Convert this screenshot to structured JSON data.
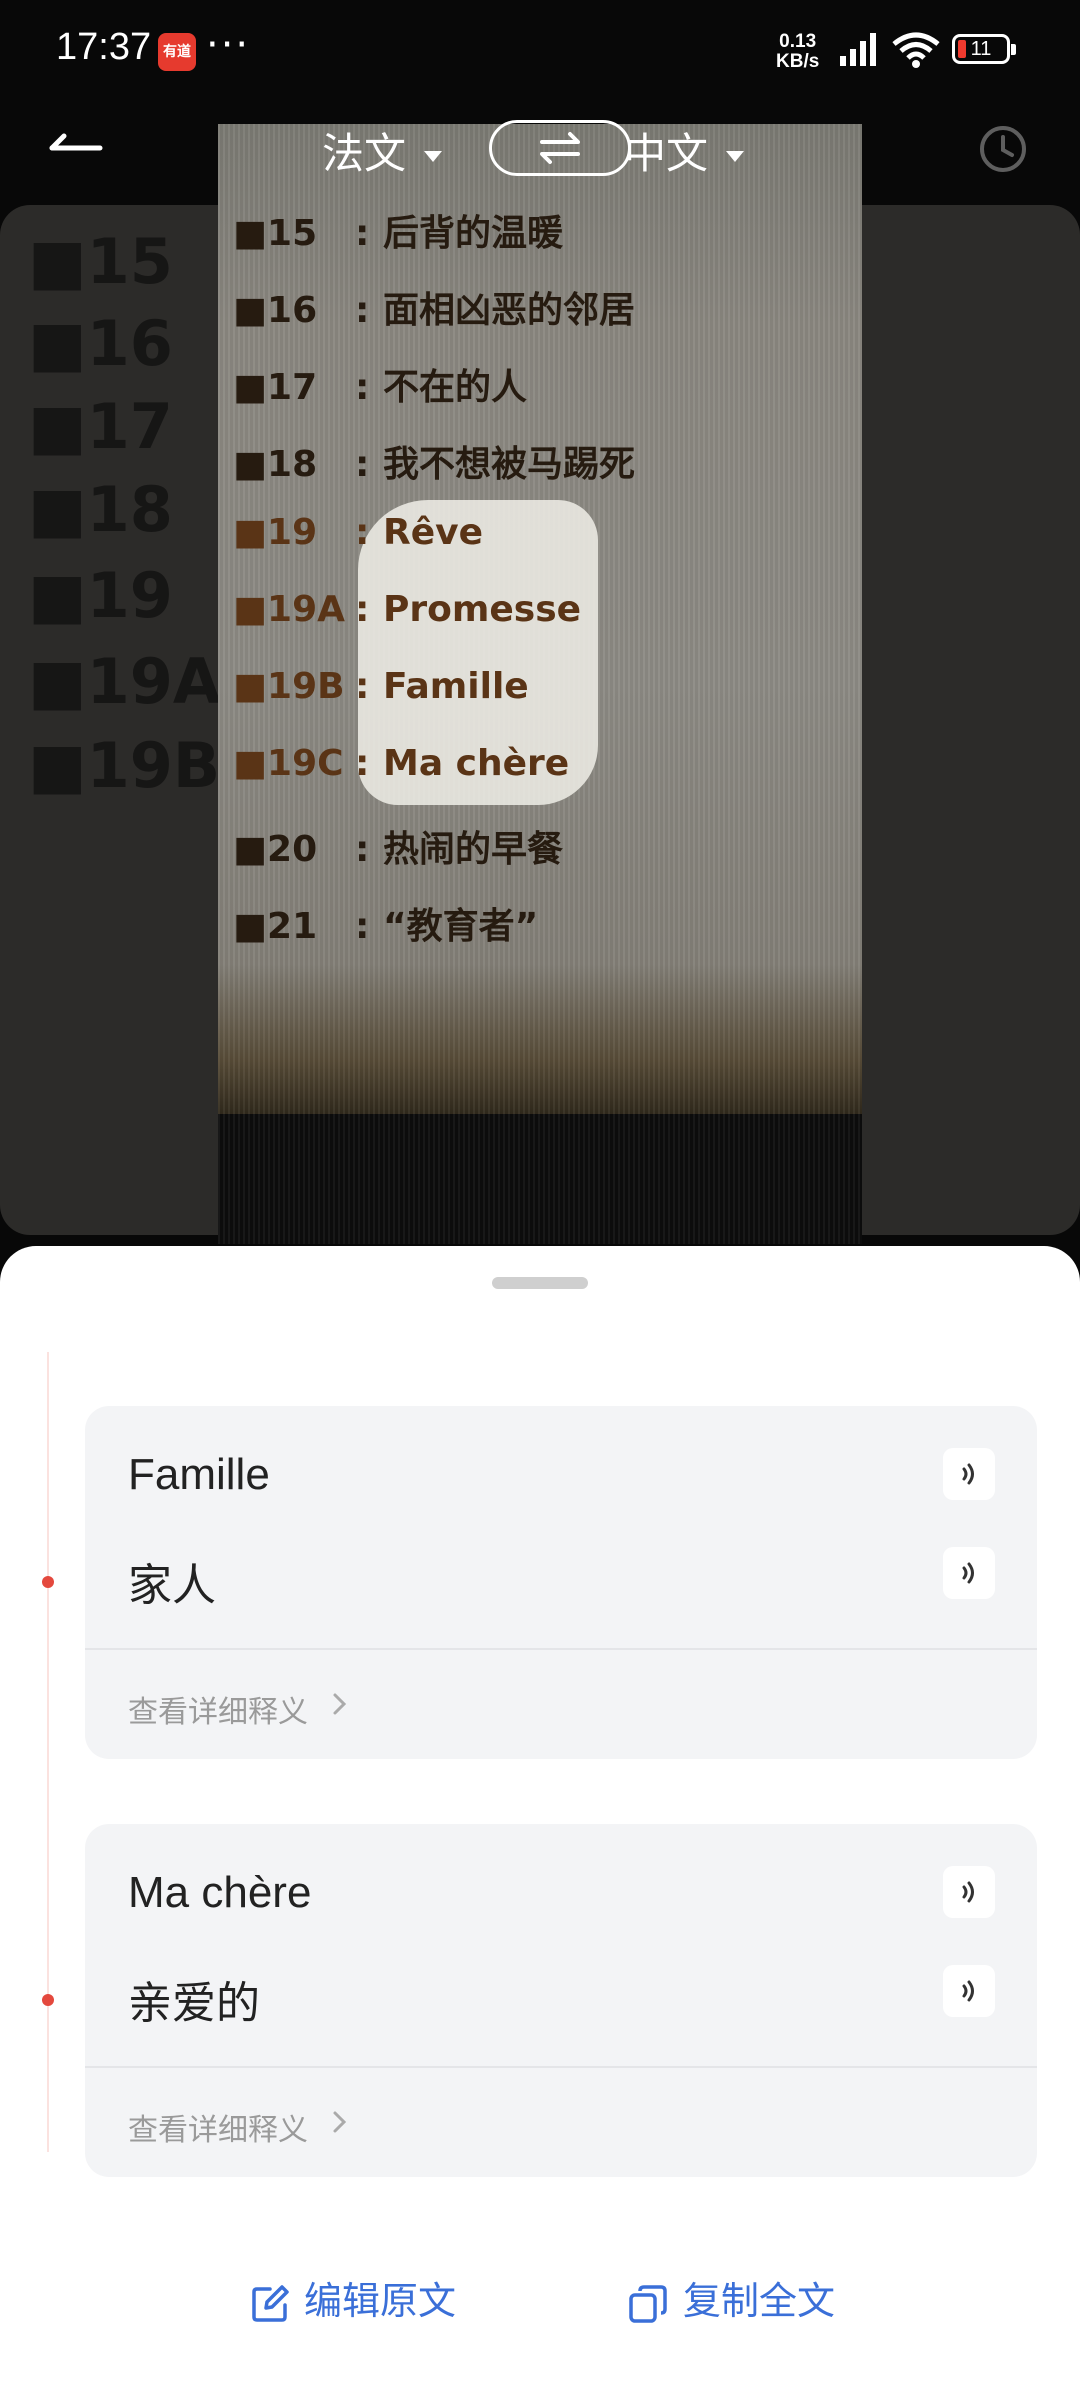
{
  "status_bar": {
    "time": "17:37",
    "app_icon_text": "有道",
    "more": "···",
    "speed_value": "0.13",
    "speed_unit": "KB/s",
    "battery": "11"
  },
  "toolbar": {
    "source_lang": "法文",
    "target_lang": "中文"
  },
  "photo_lines": [
    {
      "num": "■15",
      "text": "后背的温暖"
    },
    {
      "num": "■16",
      "text": "面相凶恶的邻居"
    },
    {
      "num": "■17",
      "text": "不在的人"
    },
    {
      "num": "■18",
      "text": "我不想被马踢死"
    },
    {
      "num": "■19",
      "text": "Rêve"
    },
    {
      "num": "■19A",
      "text": "Promesse"
    },
    {
      "num": "■19B",
      "text": "Famille"
    },
    {
      "num": "■19C",
      "text": "Ma chère"
    },
    {
      "num": "■20",
      "text": "热闹的早餐"
    },
    {
      "num": "■21",
      "text": "“教育者”"
    }
  ],
  "blur_lines": [
    "■15",
    "■16",
    "■17",
    "■18",
    "■19",
    "■19A",
    "■19B"
  ],
  "results": [
    {
      "source": "Famille",
      "translation": "家人",
      "more": "查看详细释义"
    },
    {
      "source": "Ma chère",
      "translation": "亲爱的",
      "more": "查看详细释义"
    }
  ],
  "actions": {
    "edit": "编辑原文",
    "copy": "复制全文"
  },
  "colors": {
    "accent": "#3a6fd8",
    "timeline_dot": "#e4483d"
  }
}
